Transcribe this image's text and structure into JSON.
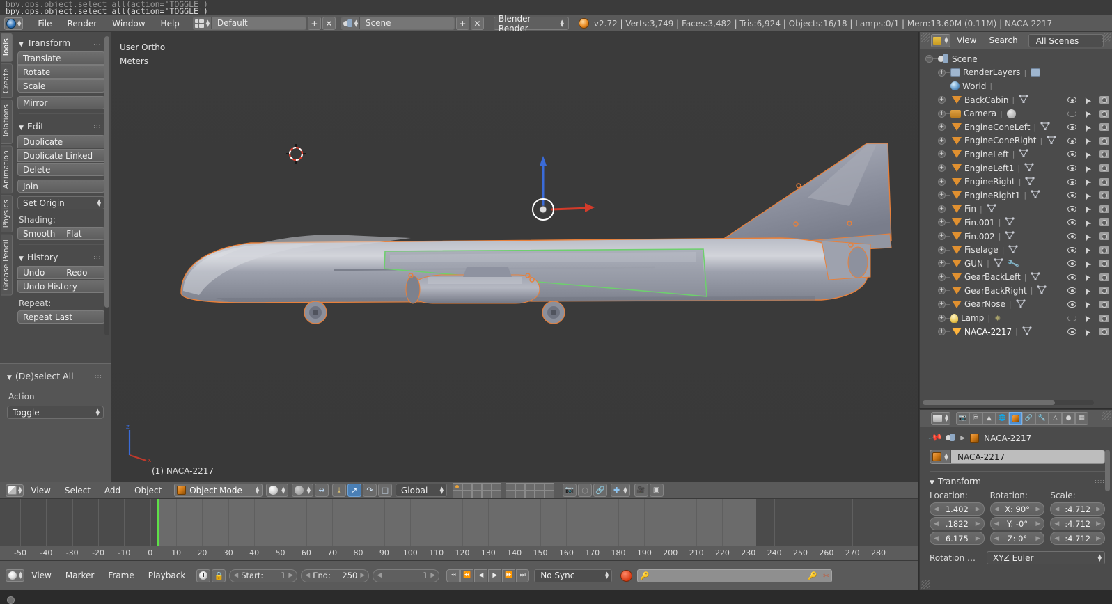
{
  "info_console": {
    "ghost_line": "bpy.ops.object.select_all(action='TOGGLE')",
    "line": "bpy.ops.object.select_all(action='TOGGLE')"
  },
  "topbar": {
    "menus": [
      "File",
      "Render",
      "Window",
      "Help"
    ],
    "screen_layout": "Default",
    "scene": "Scene",
    "engine": "Blender Render",
    "add_label": "+",
    "remove_label": "✕",
    "stats": "v2.72 | Verts:3,749 | Faces:3,482 | Tris:6,924 | Objects:16/18 | Lamps:0/1 | Mem:13.60M (0.11M) | NACA-2217"
  },
  "toolshelf": {
    "tabs": [
      "Tools",
      "Create",
      "Relations",
      "Animation",
      "Physics",
      "Grease Pencil"
    ],
    "active_tab": "Tools",
    "panels": [
      {
        "title": "Transform",
        "buttons": [
          "Translate",
          "Rotate",
          "Scale"
        ],
        "extra": [
          "Mirror"
        ]
      },
      {
        "title": "Edit",
        "buttons": [
          "Duplicate",
          "Duplicate Linked",
          "Delete"
        ],
        "join": "Join",
        "set_origin": "Set Origin",
        "shading_label": "Shading:",
        "shading": [
          "Smooth",
          "Flat"
        ]
      },
      {
        "title": "History",
        "undo": "Undo",
        "redo": "Redo",
        "undo_history": "Undo History",
        "repeat_label": "Repeat:",
        "repeat_last": "Repeat Last"
      }
    ]
  },
  "operator_panel": {
    "title": "(De)select All",
    "action_label": "Action",
    "action_value": "Toggle"
  },
  "viewport": {
    "view_name": "User Ortho",
    "units": "Meters",
    "object_label": "(1) NACA-2217",
    "axis_x": "x",
    "axis_z": "z"
  },
  "viewport_header": {
    "menus": [
      "View",
      "Select",
      "Add",
      "Object"
    ],
    "mode": "Object Mode",
    "transform_orientation": "Global"
  },
  "timeline": {
    "ticks": [
      "-50",
      "-40",
      "-30",
      "-20",
      "-10",
      "0",
      "10",
      "20",
      "30",
      "40",
      "50",
      "60",
      "70",
      "80",
      "90",
      "100",
      "110",
      "120",
      "130",
      "140",
      "150",
      "160",
      "170",
      "180",
      "190",
      "200",
      "210",
      "220",
      "230",
      "240",
      "250",
      "260",
      "270",
      "280"
    ],
    "playhead_frame": 0,
    "menus": [
      "View",
      "Marker",
      "Frame",
      "Playback"
    ],
    "start_label": "Start:",
    "start_value": "1",
    "end_label": "End:",
    "end_value": "250",
    "current_frame": "1",
    "sync_mode": "No Sync"
  },
  "outliner": {
    "menus": [
      "View",
      "Search"
    ],
    "filter": "All Scenes",
    "rows": [
      {
        "name": "Scene",
        "level": 0,
        "type": "scene",
        "expander": "−",
        "eye": false,
        "mesh": false
      },
      {
        "name": "RenderLayers",
        "level": 1,
        "type": "renderlayers",
        "expander": "+",
        "eye": false,
        "mesh": false
      },
      {
        "name": "World",
        "level": 1,
        "type": "world",
        "expander": "",
        "eye": false,
        "mesh": false
      },
      {
        "name": "BackCabin",
        "level": 1,
        "type": "mesh",
        "expander": "+",
        "eye": true,
        "mesh": true
      },
      {
        "name": "Camera",
        "level": 1,
        "type": "camera",
        "expander": "+",
        "eye": "off",
        "mesh": false
      },
      {
        "name": "EngineConeLeft",
        "level": 1,
        "type": "mesh",
        "expander": "+",
        "eye": true,
        "mesh": true
      },
      {
        "name": "EngineConeRight",
        "level": 1,
        "type": "mesh",
        "expander": "+",
        "eye": true,
        "mesh": true
      },
      {
        "name": "EngineLeft",
        "level": 1,
        "type": "mesh",
        "expander": "+",
        "eye": true,
        "mesh": true
      },
      {
        "name": "EngineLeft1",
        "level": 1,
        "type": "mesh",
        "expander": "+",
        "eye": true,
        "mesh": true
      },
      {
        "name": "EngineRight",
        "level": 1,
        "type": "mesh",
        "expander": "+",
        "eye": true,
        "mesh": true
      },
      {
        "name": "EngineRight1",
        "level": 1,
        "type": "mesh",
        "expander": "+",
        "eye": true,
        "mesh": true
      },
      {
        "name": "Fin",
        "level": 1,
        "type": "mesh",
        "expander": "+",
        "eye": true,
        "mesh": true
      },
      {
        "name": "Fin.001",
        "level": 1,
        "type": "mesh",
        "expander": "+",
        "eye": true,
        "mesh": true
      },
      {
        "name": "Fin.002",
        "level": 1,
        "type": "mesh",
        "expander": "+",
        "eye": true,
        "mesh": true
      },
      {
        "name": "Fiselage",
        "level": 1,
        "type": "mesh",
        "expander": "+",
        "eye": true,
        "mesh": true
      },
      {
        "name": "GUN",
        "level": 1,
        "type": "mesh",
        "expander": "+",
        "eye": true,
        "mesh": true,
        "wrench": true
      },
      {
        "name": "GearBackLeft",
        "level": 1,
        "type": "mesh",
        "expander": "+",
        "eye": true,
        "mesh": true
      },
      {
        "name": "GearBackRight",
        "level": 1,
        "type": "mesh",
        "expander": "+",
        "eye": true,
        "mesh": true
      },
      {
        "name": "GearNose",
        "level": 1,
        "type": "mesh",
        "expander": "+",
        "eye": true,
        "mesh": true
      },
      {
        "name": "Lamp",
        "level": 1,
        "type": "lamp",
        "expander": "+",
        "eye": "off",
        "mesh": false
      },
      {
        "name": "NACA-2217",
        "level": 1,
        "type": "mesh",
        "expander": "+",
        "eye": true,
        "mesh": true,
        "selected": true
      }
    ]
  },
  "properties": {
    "breadcrumb_scene": "Scene",
    "breadcrumb_object": "NACA-2217",
    "object_name": "NACA-2217",
    "transform_title": "Transform",
    "location_label": "Location:",
    "rotation_label": "Rotation:",
    "scale_label": "Scale:",
    "location": [
      "1.402",
      ".1822",
      "6.175"
    ],
    "rotation": [
      "X: 90°",
      "Y:  -0°",
      "Z:  0°"
    ],
    "scale": [
      ":4.712",
      ":4.712",
      ":4.712"
    ],
    "rotation_mode_label": "Rotation …",
    "rotation_mode": "XYZ Euler"
  },
  "colors": {
    "accent_orange": "#e09030",
    "selection_outline": "#e8803a",
    "playhead_green": "#5ee048",
    "tab_active_blue": "#4f8fd0",
    "bg_panel": "#4b4b4b",
    "bg_header": "#5a5a5a"
  }
}
